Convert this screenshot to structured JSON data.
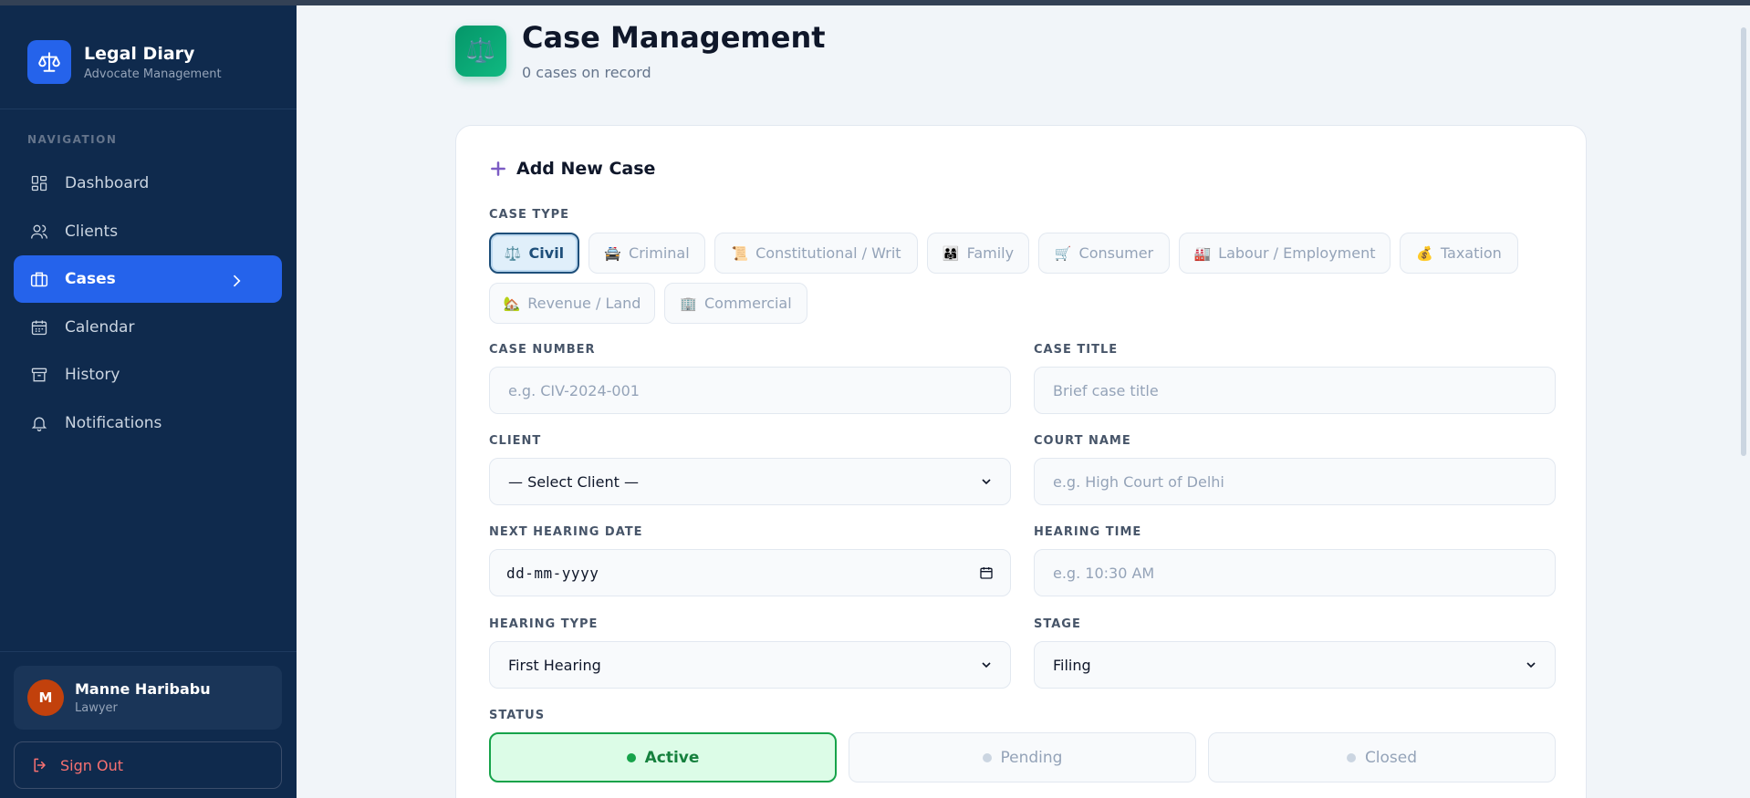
{
  "sidebar": {
    "brand_title": "Legal Diary",
    "brand_subtitle": "Advocate Management",
    "nav_section": "NAVIGATION",
    "items": [
      {
        "label": "Dashboard",
        "icon": "grid-icon"
      },
      {
        "label": "Clients",
        "icon": "users-icon"
      },
      {
        "label": "Cases",
        "icon": "briefcase-icon",
        "active": true
      },
      {
        "label": "Calendar",
        "icon": "calendar-icon"
      },
      {
        "label": "History",
        "icon": "archive-icon"
      },
      {
        "label": "Notifications",
        "icon": "bell-icon"
      }
    ],
    "user": {
      "initial": "M",
      "name": "Manne Haribabu",
      "role": "Lawyer"
    },
    "signout_label": "Sign Out"
  },
  "header": {
    "icon": "⚖️",
    "title": "Case Management",
    "subtitle": "0 cases on record"
  },
  "form": {
    "heading": "Add New Case",
    "case_type_label": "CASE TYPE",
    "case_types": [
      {
        "emoji": "⚖️",
        "label": "Civil",
        "active": true
      },
      {
        "emoji": "🚔",
        "label": "Criminal"
      },
      {
        "emoji": "📜",
        "label": "Constitutional / Writ"
      },
      {
        "emoji": "👨‍👩‍👧",
        "label": "Family"
      },
      {
        "emoji": "🛒",
        "label": "Consumer"
      },
      {
        "emoji": "🏭",
        "label": "Labour / Employment"
      },
      {
        "emoji": "💰",
        "label": "Taxation"
      },
      {
        "emoji": "🏡",
        "label": "Revenue / Land"
      },
      {
        "emoji": "🏢",
        "label": "Commercial"
      }
    ],
    "case_number_label": "CASE NUMBER",
    "case_number_placeholder": "e.g. CIV-2024-001",
    "case_title_label": "CASE TITLE",
    "case_title_placeholder": "Brief case title",
    "client_label": "CLIENT",
    "client_value": "— Select Client —",
    "court_name_label": "COURT NAME",
    "court_name_placeholder": "e.g. High Court of Delhi",
    "next_hearing_label": "NEXT HEARING DATE",
    "next_hearing_placeholder": "dd-mm-yyyy",
    "hearing_time_label": "HEARING TIME",
    "hearing_time_placeholder": "e.g. 10:30 AM",
    "hearing_type_label": "HEARING TYPE",
    "hearing_type_value": "First Hearing",
    "stage_label": "STAGE",
    "stage_value": "Filing",
    "status_label": "STATUS",
    "statuses": [
      {
        "label": "Active",
        "active": true
      },
      {
        "label": "Pending"
      },
      {
        "label": "Closed"
      }
    ]
  },
  "colors": {
    "sidebar_bg": "#0f2a4d",
    "accent": "#2563eb",
    "success": "#16a34a",
    "danger": "#f87171"
  }
}
